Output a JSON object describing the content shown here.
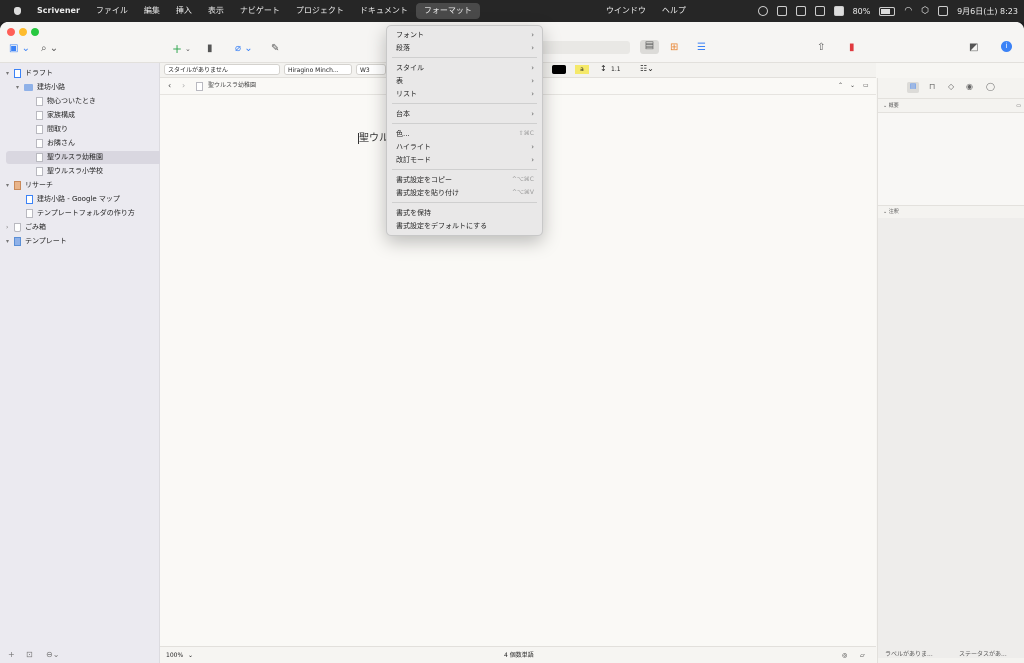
{
  "menubar": {
    "apple": "",
    "app_name": "Scrivener",
    "items": [
      "ファイル",
      "編集",
      "挿入",
      "表示",
      "ナビゲート",
      "プロジェクト",
      "ドキュメント",
      "フォーマット"
    ],
    "right_items": [
      "ウインドウ",
      "ヘルプ"
    ],
    "battery": "80%",
    "clock": "9月6日(土)  8:23"
  },
  "formatbar": {
    "style": "スタイルがありません",
    "font": "Hiragino Minch...",
    "weight": "W3",
    "line_spacing": "1.1",
    "highlight_letter": "a"
  },
  "sidebar": {
    "items": [
      {
        "label": "ドラフト",
        "level": 0,
        "chev": "▾",
        "type": "draft"
      },
      {
        "label": "建坊小路",
        "level": 1,
        "chev": "▾",
        "type": "folder"
      },
      {
        "label": "物心ついたとき",
        "level": 2,
        "chev": "",
        "type": "doc"
      },
      {
        "label": "家族構成",
        "level": 2,
        "chev": "",
        "type": "doc"
      },
      {
        "label": "間取り",
        "level": 2,
        "chev": "",
        "type": "doc"
      },
      {
        "label": "お隣さん",
        "level": 2,
        "chev": "",
        "type": "doc"
      },
      {
        "label": "聖ウルスラ幼稚園",
        "level": 2,
        "chev": "",
        "type": "doc",
        "selected": true
      },
      {
        "label": "聖ウルスラ小学校",
        "level": 2,
        "chev": "",
        "type": "doc"
      },
      {
        "label": "リサーチ",
        "level": 0,
        "chev": "▾",
        "type": "research"
      },
      {
        "label": "建坊小路 - Google マップ",
        "level": 1,
        "chev": "",
        "type": "web"
      },
      {
        "label": "テンプレートフォルダの作り方",
        "level": 1,
        "chev": "",
        "type": "doc"
      },
      {
        "label": "ごみ箱",
        "level": 0,
        "chev": "›",
        "type": "trash"
      },
      {
        "label": "テンプレート",
        "level": 0,
        "chev": "▾",
        "type": "template"
      }
    ]
  },
  "editor": {
    "breadcrumb": "聖ウルスラ幼稚園",
    "body_text": "聖ウル",
    "zoom": "100%",
    "word_count": "4 個数単語"
  },
  "inspector": {
    "synopsis_label": "概要",
    "notes_label": "注釈",
    "label_select": "ラベルがありま...",
    "status_select": "ステータスがあ..."
  },
  "format_menu": {
    "items": [
      {
        "label": "フォント",
        "sub": true
      },
      {
        "label": "段落",
        "sub": true
      },
      {
        "sep": true
      },
      {
        "label": "スタイル",
        "sub": true
      },
      {
        "label": "表",
        "sub": true
      },
      {
        "label": "リスト",
        "sub": true
      },
      {
        "sep": true
      },
      {
        "label": "台本",
        "sub": true
      },
      {
        "sep": true
      },
      {
        "label": "色...",
        "shortcut": "⇧⌘C"
      },
      {
        "label": "ハイライト",
        "sub": true
      },
      {
        "label": "改訂モード",
        "sub": true
      },
      {
        "sep": true
      },
      {
        "label": "書式設定をコピー",
        "shortcut": "^⌥⌘C"
      },
      {
        "label": "書式設定を貼り付け",
        "shortcut": "^⌥⌘V"
      },
      {
        "sep": true
      },
      {
        "label": "書式を保持"
      },
      {
        "label": "書式設定をデフォルトにする"
      }
    ]
  },
  "colors": {
    "accent": "#3b82f6",
    "red": "#ff5f57",
    "yellow": "#febc2e",
    "green": "#28c840",
    "bookmark": "#e0393e"
  }
}
